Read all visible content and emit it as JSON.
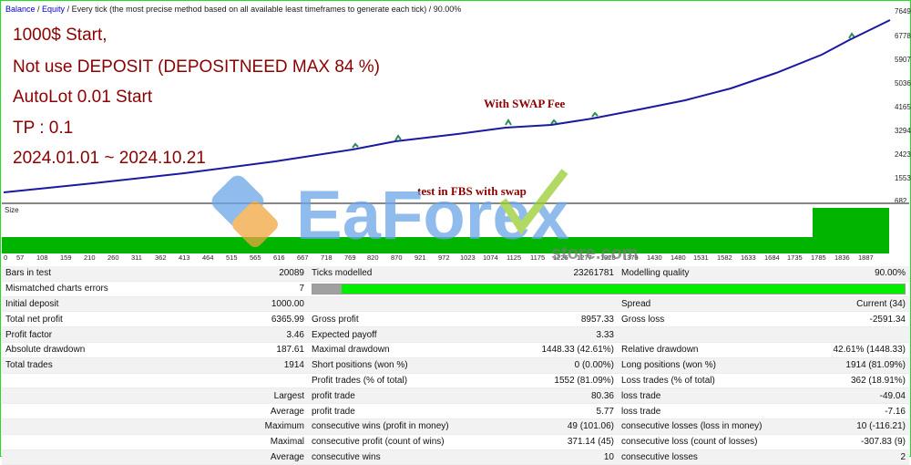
{
  "header": {
    "balance": "Balance",
    "sep": " / ",
    "equity": "Equity",
    "rest": " / Every tick (the most precise method based on all available least timeframes to generate each tick)  /  90.00%"
  },
  "annotations": {
    "line1": "1000$ Start,",
    "line2": "Not use DEPOSIT (DEPOSITNEED MAX 84 %)",
    "line3": "AutoLot 0.01 Start",
    "line4": "TP : 0.1",
    "line5": "2024.01.01 ~ 2024.10.21",
    "swap": "With SWAP  Fee",
    "fbs": "test in FBS with swap"
  },
  "axis": {
    "y_labels": [
      "7649",
      "6778",
      "5907",
      "5036",
      "4165",
      "3294",
      "2423",
      "1553",
      "682"
    ],
    "x_labels": [
      "0",
      "57",
      "108",
      "159",
      "210",
      "260",
      "311",
      "362",
      "413",
      "464",
      "515",
      "565",
      "616",
      "667",
      "718",
      "769",
      "820",
      "870",
      "921",
      "972",
      "1023",
      "1074",
      "1125",
      "1175",
      "1226",
      "1277",
      "1328",
      "1379",
      "1430",
      "1480",
      "1531",
      "1582",
      "1633",
      "1684",
      "1735",
      "1785",
      "1836",
      "1887"
    ],
    "size_label": "Size"
  },
  "colors": {
    "balance_line": "#1a1aa0",
    "equity_line": "#2e8b57",
    "size_bars": "#00b400",
    "annotation": "#8b0000"
  },
  "watermark": {
    "brand": "EaForex",
    "sub": "store.com"
  },
  "report": {
    "bars_label": "Bars in test",
    "bars": "20089",
    "ticks_label": "Ticks modelled",
    "ticks": "23261781",
    "mq_label": "Modelling quality",
    "mq": "90.00%",
    "mismatch_label": "Mismatched charts errors",
    "mismatch": "7",
    "init_label": "Initial deposit",
    "init": "1000.00",
    "spread_label": "Spread",
    "spread": "Current (34)",
    "net_label": "Total net profit",
    "net": "6365.99",
    "gp_label": "Gross profit",
    "gp": "8957.33",
    "gl_label": "Gross loss",
    "gl": "-2591.34",
    "pf_label": "Profit factor",
    "pf": "3.46",
    "ep_label": "Expected payoff",
    "ep": "3.33",
    "ad_label": "Absolute drawdown",
    "ad": "187.61",
    "md_label": "Maximal drawdown",
    "md": "1448.33 (42.61%)",
    "rd_label": "Relative drawdown",
    "rd": "42.61% (1448.33)",
    "tt_label": "Total trades",
    "tt": "1914",
    "sp_label": "Short positions (won %)",
    "sp": "0 (0.00%)",
    "lp_label": "Long positions (won %)",
    "lp": "1914 (81.09%)",
    "pt_label": "Profit trades (% of total)",
    "pt": "1552 (81.09%)",
    "lt_label": "Loss trades (% of total)",
    "lt": "362 (18.91%)",
    "largest": "Largest",
    "avg1": "Average",
    "maximum": "Maximum",
    "maximal": "Maximal",
    "avg2": "Average",
    "lpt_label": "profit trade",
    "lpt": "80.36",
    "llt_label": "loss trade",
    "llt": "-49.04",
    "apt_label": "profit trade",
    "apt": "5.77",
    "alt_label": "loss trade",
    "alt": "-7.16",
    "mcw_label": "consecutive wins (profit in money)",
    "mcw": "49 (101.06)",
    "mcl_label": "consecutive losses (loss in money)",
    "mcl": "10 (-116.21)",
    "mcp_label": "consecutive profit (count of wins)",
    "mcp": "371.14 (45)",
    "mcls_label": "consecutive loss (count of losses)",
    "mcls": "-307.83 (9)",
    "acw_label": "consecutive wins",
    "acw": "10",
    "acl_label": "consecutive losses",
    "acl": "2"
  }
}
